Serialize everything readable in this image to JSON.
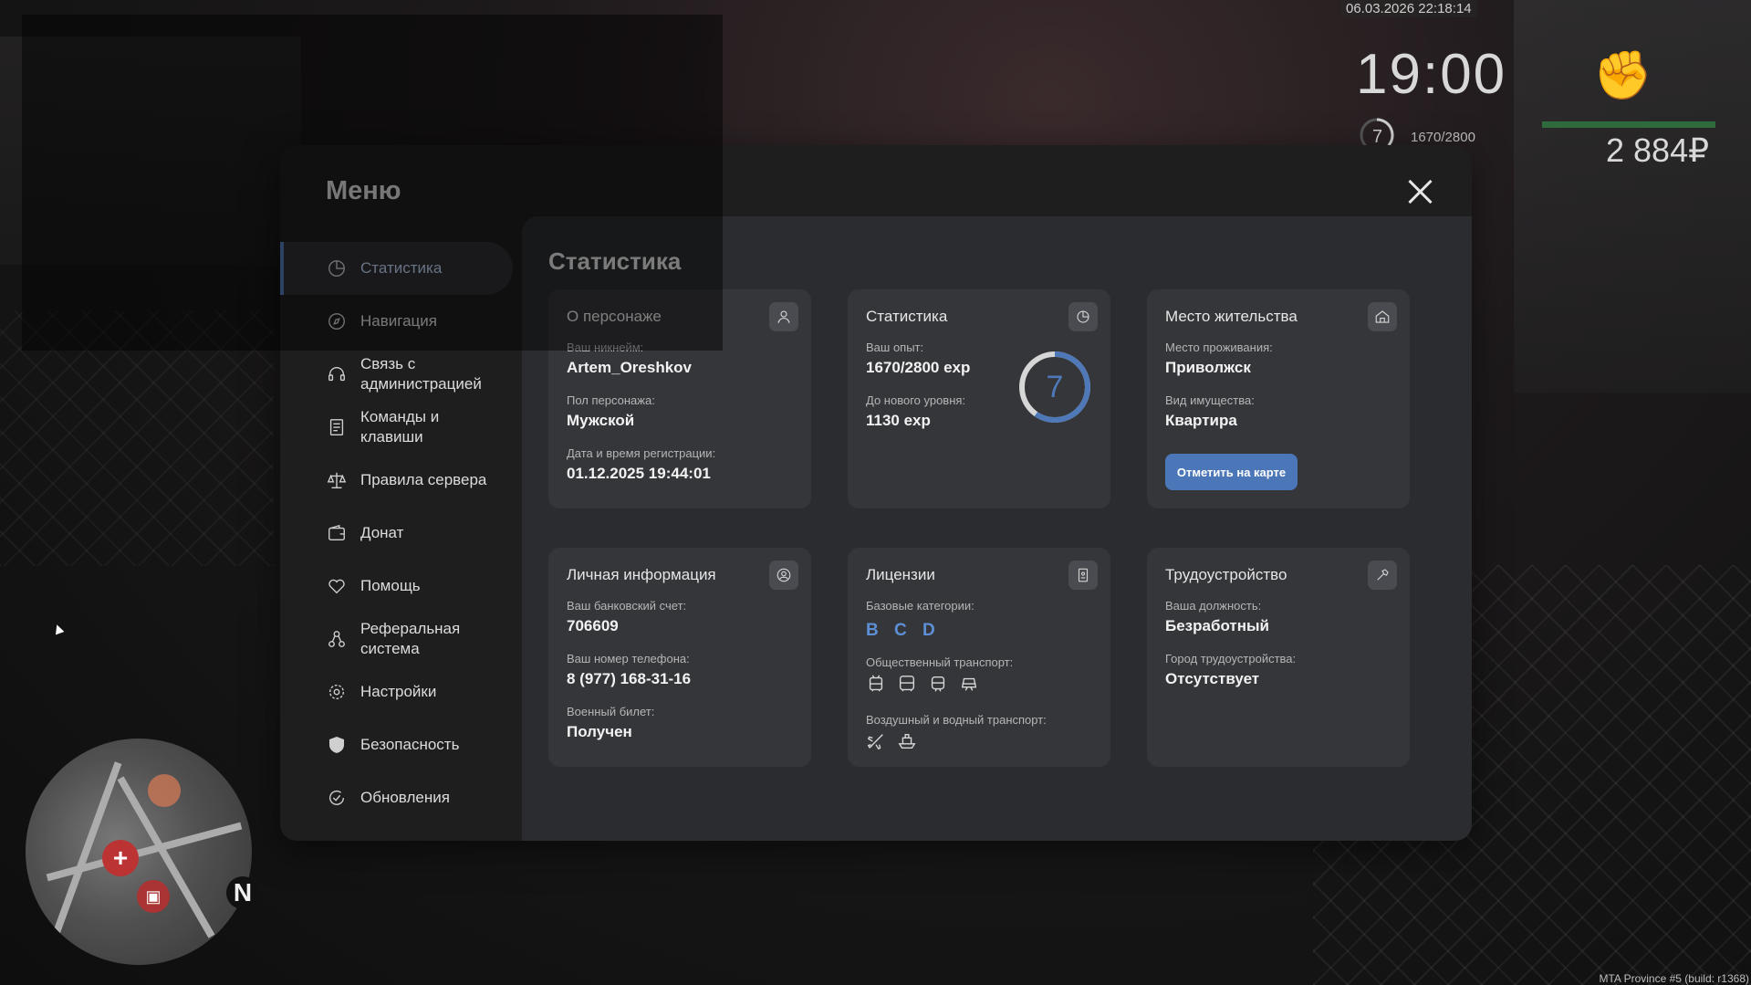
{
  "hud": {
    "datetime": "06.03.2026 22:18:14",
    "clock": "19:00",
    "level": "7",
    "exp": "1670/2800",
    "money": "2 884₽",
    "build": "MTA Province #5 (build: r1368)"
  },
  "minimap": {
    "north": "N"
  },
  "menu": {
    "title": "Меню",
    "nav": [
      {
        "label": "Статистика",
        "icon": "chart-pie-icon"
      },
      {
        "label": "Навигация",
        "icon": "compass-icon"
      },
      {
        "label": "Связь с администрацией",
        "icon": "headset-icon"
      },
      {
        "label": "Команды и клавиши",
        "icon": "document-icon"
      },
      {
        "label": "Правила сервера",
        "icon": "scales-icon"
      },
      {
        "label": "Донат",
        "icon": "wallet-icon"
      },
      {
        "label": "Помощь",
        "icon": "handshake-heart-icon"
      },
      {
        "label": "Реферальная система",
        "icon": "referral-nodes-icon"
      },
      {
        "label": "Настройки",
        "icon": "gear-icon"
      },
      {
        "label": "Безопасность",
        "icon": "shield-icon"
      },
      {
        "label": "Обновления",
        "icon": "refresh-check-icon"
      }
    ]
  },
  "content": {
    "title": "Статистика",
    "character": {
      "title": "О персонаже",
      "nick_label": "Ваш никнейм:",
      "nick": "Artem_Oreshkov",
      "gender_label": "Пол персонажа:",
      "gender": "Мужской",
      "reg_label": "Дата и время регистрации:",
      "reg": "01.12.2025 19:44:01"
    },
    "stats": {
      "title": "Статистика",
      "exp_label": "Ваш опыт:",
      "exp": "1670/2800 exp",
      "next_label": "До нового уровня:",
      "next": "1130 exp",
      "level": "7",
      "progress": 0.596
    },
    "residence": {
      "title": "Место жительства",
      "place_label": "Место проживания:",
      "place": "Приволжск",
      "type_label": "Вид имущества:",
      "type": "Квартира",
      "button": "Отметить на карте"
    },
    "personal": {
      "title": "Личная информация",
      "bank_label": "Ваш банковский счет:",
      "bank": "706609",
      "phone_label": "Ваш номер телефона:",
      "phone": "8 (977) 168-31-16",
      "military_label": "Военный билет:",
      "military": "Получен"
    },
    "licenses": {
      "title": "Лицензии",
      "base_label": "Базовые категории:",
      "base": "B C D",
      "public_label": "Общественный транспорт:",
      "air_label": "Воздушный и водный транспорт:"
    },
    "job": {
      "title": "Трудоустройство",
      "position_label": "Ваша должность:",
      "position": "Безработный",
      "city_label": "Город трудоустройства:",
      "city": "Отсутствует"
    }
  },
  "colors": {
    "accent": "#4f78b8",
    "panel": "#1e1e1f",
    "card": "#35363a",
    "health": "#2e6a3c"
  }
}
